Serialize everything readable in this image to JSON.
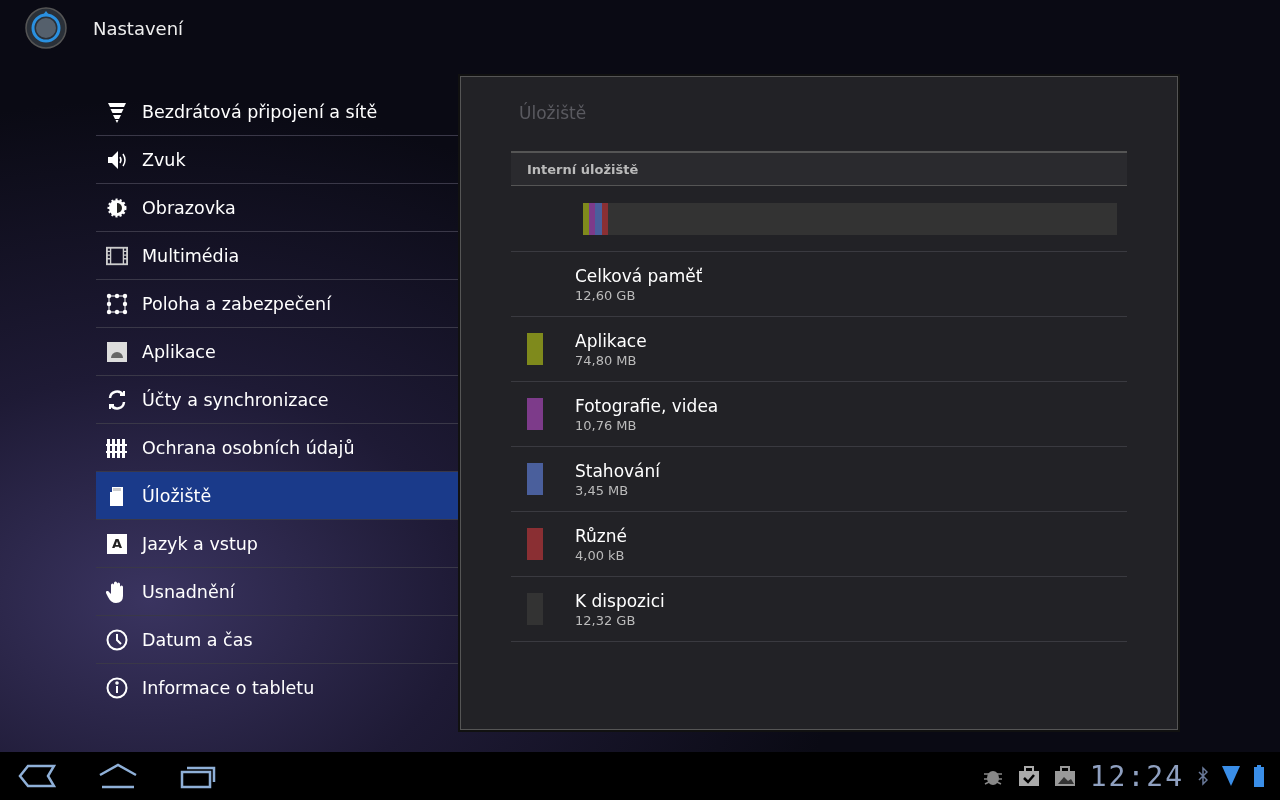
{
  "app_bar": {
    "title": "Nastavení"
  },
  "sidebar": {
    "items": [
      {
        "label": "Bezdrátová připojení a sítě",
        "selected": false
      },
      {
        "label": "Zvuk",
        "selected": false
      },
      {
        "label": "Obrazovka",
        "selected": false
      },
      {
        "label": "Multimédia",
        "selected": false
      },
      {
        "label": "Poloha a zabezpečení",
        "selected": false
      },
      {
        "label": "Aplikace",
        "selected": false
      },
      {
        "label": "Účty a synchronizace",
        "selected": false
      },
      {
        "label": "Ochrana osobních údajů",
        "selected": false
      },
      {
        "label": "Úložiště",
        "selected": true
      },
      {
        "label": "Jazyk a vstup",
        "glyph": "A",
        "selected": false
      },
      {
        "label": "Usnadnění",
        "selected": false
      },
      {
        "label": "Datum a čas",
        "selected": false
      },
      {
        "label": "Informace o tabletu",
        "selected": false
      }
    ]
  },
  "panel": {
    "title": "Úložiště",
    "section_header": "Interní úložiště",
    "items": [
      {
        "kind": "total",
        "title": "Celková paměť",
        "value": "12,60 GB"
      },
      {
        "kind": "used",
        "title": "Aplikace",
        "value": "74,80 MB",
        "color": "#7f8a1c",
        "level": 0.012
      },
      {
        "kind": "used",
        "title": "Fotografie, videa",
        "value": "10,76 MB",
        "color": "#7d3b8a",
        "level": 0.011
      },
      {
        "kind": "used",
        "title": "Stahování",
        "value": "3,45 MB",
        "color": "#4a5f9c",
        "level": 0.012
      },
      {
        "kind": "used",
        "title": "Různé",
        "value": "4,00 kB",
        "color": "#8a2f33",
        "level": 0.011
      },
      {
        "kind": "free",
        "title": "K dispozici",
        "value": "12,32 GB",
        "color": "#333333"
      }
    ]
  },
  "status_bar": {
    "time": "12:24"
  }
}
